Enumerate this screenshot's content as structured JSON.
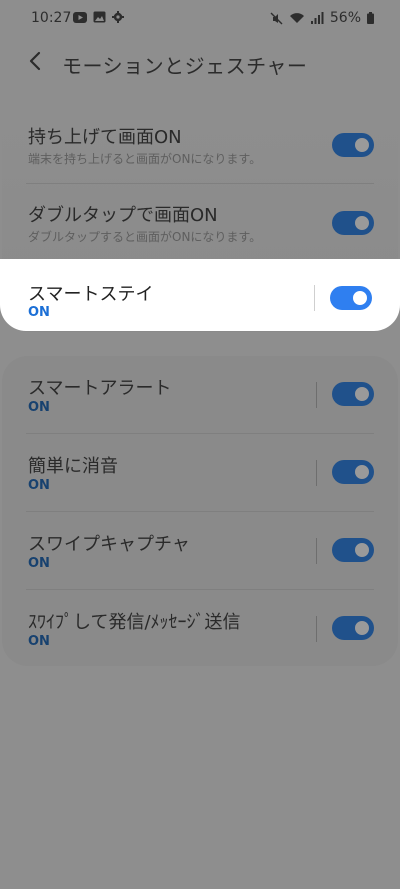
{
  "status_bar": {
    "time": "10:27",
    "left_icons": [
      "youtube-icon",
      "gallery-icon",
      "settings-gear-icon"
    ],
    "right_icons": [
      "mute-icon",
      "wifi-icon",
      "signal-icon"
    ],
    "battery_text": "56%"
  },
  "header": {
    "title": "モーションとジェスチャー"
  },
  "settings": [
    {
      "title": "持ち上げて画面ON",
      "subtitle": "端末を持ち上げると画面がONになります。",
      "enabled": true
    },
    {
      "title": "ダブルタップで画面ON",
      "subtitle": "ダブルタップすると画面がONになります。",
      "enabled": true
    },
    {
      "title": "スマートステイ",
      "status": "ON",
      "enabled": true,
      "highlighted": true
    },
    {
      "title": "スマートアラート",
      "status": "ON",
      "enabled": true
    },
    {
      "title": "簡単に消音",
      "status": "ON",
      "enabled": true
    },
    {
      "title": "スワイプキャプチャ",
      "status": "ON",
      "enabled": true
    },
    {
      "title": "ｽﾜｲﾌﾟして発信/ﾒｯｾｰｼﾞ送信",
      "status": "ON",
      "enabled": true
    }
  ],
  "colors": {
    "dim_background": "#8e8e8e",
    "toggle_on": "#2f7ff0",
    "status_on": "#1b6fd6"
  }
}
